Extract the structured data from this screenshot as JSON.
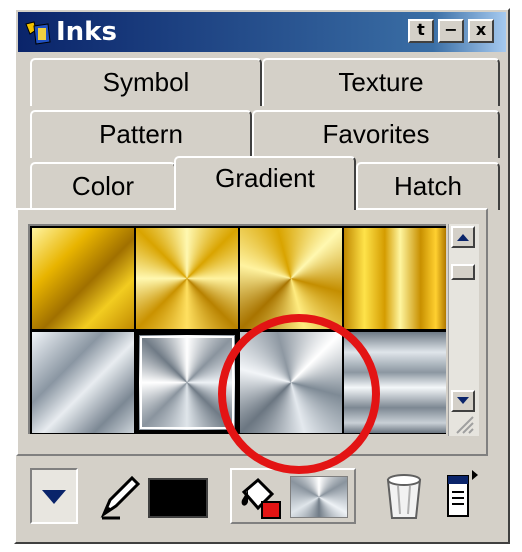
{
  "window": {
    "title": "Inks",
    "buttons": {
      "pin": "t",
      "minimize": "−",
      "close": "x"
    }
  },
  "tabs": {
    "row1": [
      "Symbol",
      "Texture"
    ],
    "row2": [
      "Pattern",
      "Favorites"
    ],
    "row3": [
      "Color",
      "Gradient",
      "Hatch"
    ],
    "active": "Gradient"
  },
  "gradients": [
    {
      "style": "linear-diagonal",
      "palette": "gold"
    },
    {
      "style": "conical",
      "palette": "gold"
    },
    {
      "style": "conical-rotated",
      "palette": "gold"
    },
    {
      "style": "linear-vertical-bands",
      "palette": "gold"
    },
    {
      "style": "linear-diagonal",
      "palette": "silver"
    },
    {
      "style": "conical",
      "palette": "silver",
      "selected": true
    },
    {
      "style": "conical-rotated",
      "palette": "silver"
    },
    {
      "style": "linear-horizontal-bands",
      "palette": "silver"
    }
  ],
  "colors": {
    "accent": "#0a246a",
    "highlight_circle": "#e31414",
    "gold": "#e6b800",
    "silver": "#a9b3bc"
  },
  "toolbar": [
    {
      "name": "dropdown-arrow-icon"
    },
    {
      "name": "pen-icon"
    },
    {
      "name": "line-color-swatch",
      "color": "#000000"
    },
    {
      "name": "paint-bucket-icon"
    },
    {
      "name": "fill-swatch"
    },
    {
      "name": "trash-icon"
    },
    {
      "name": "menu-icon"
    }
  ]
}
